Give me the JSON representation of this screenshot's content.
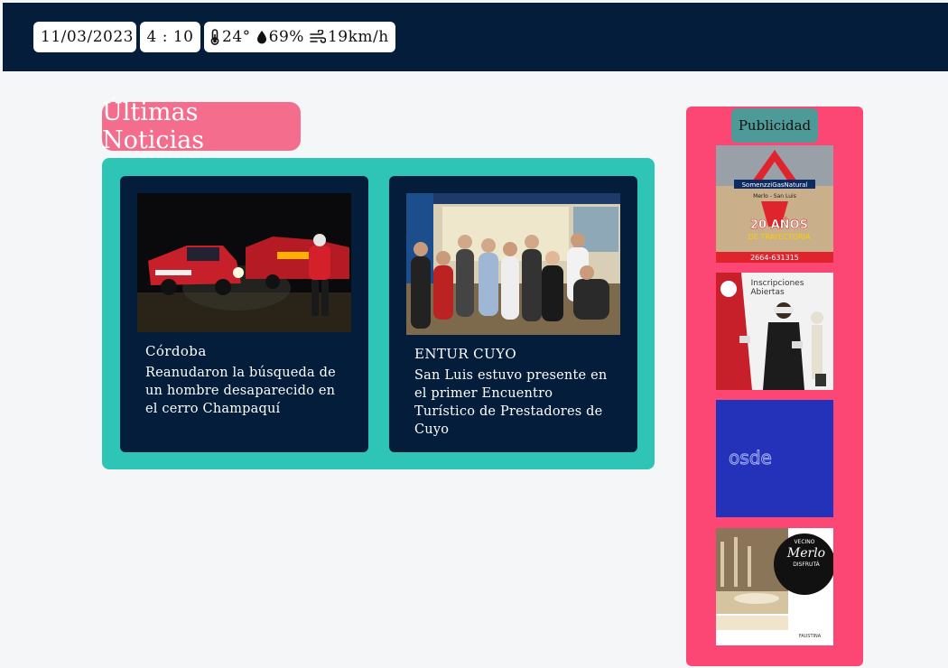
{
  "header": {
    "date": "11/03/2023",
    "time": "4 : 10",
    "weather": {
      "temperature": "24°",
      "humidity": "69%",
      "wind": "19km/h",
      "icons": [
        "thermometer-icon",
        "droplet-icon",
        "wind-icon"
      ]
    }
  },
  "news": {
    "title": "Últimas Noticias",
    "items": [
      {
        "category": "Córdoba",
        "headline": "Reanudaron la búsqueda de un hombre desaparecido en el cerro Champaquí"
      },
      {
        "category": "ENTUR CUYO",
        "headline": "San Luis estuvo presente en el primer Encuentro Turístico de Prestadores de Cuyo"
      }
    ]
  },
  "ads": {
    "title": "Publicidad",
    "items": [
      {
        "brand": "SomenzziGasNatural",
        "sub": "Merlo - San Luis",
        "tagline": "20 AÑOS",
        "tagline2": "DE TRAYECTORIA",
        "phone": "2664-631315"
      },
      {
        "heading": "Inscripciones",
        "heading2": "Abiertas"
      },
      {
        "brand": "osde"
      },
      {
        "line1": "VECINO",
        "line2": "Merlo",
        "line3": "DISFRUTÁ",
        "footer": "FAUSTINA"
      }
    ]
  },
  "colors": {
    "header_bg": "#031d3b",
    "accent_pink": "#f46d8c",
    "news_panel": "#2ec4b6",
    "ads_panel": "#fc4673",
    "ads_title": "#4e9a98"
  }
}
